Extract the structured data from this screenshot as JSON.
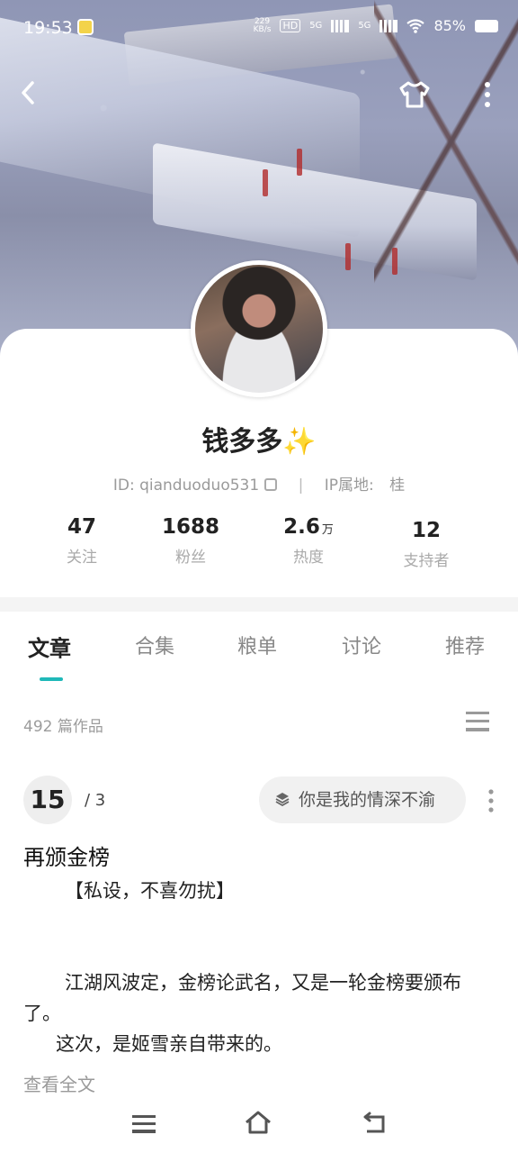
{
  "status_bar": {
    "time": "19:53",
    "net_speed_value": "229",
    "net_speed_unit": "KB/s",
    "hd_badge": "HD",
    "sim1_label": "5G",
    "sim2_label": "5G",
    "battery": "85%"
  },
  "profile": {
    "name": "钱多多✨",
    "id_label": "ID: qianduoduo531",
    "separator": "|",
    "ip_label": "IP属地:",
    "ip_value": "桂"
  },
  "stats": [
    {
      "value": "47",
      "unit": "",
      "label": "关注"
    },
    {
      "value": "1688",
      "unit": "",
      "label": "粉丝"
    },
    {
      "value": "2.6",
      "unit": "万",
      "label": "热度"
    },
    {
      "value": "12",
      "unit": "",
      "label": "支持者"
    }
  ],
  "tabs": [
    {
      "label": "文章",
      "active": true
    },
    {
      "label": "合集",
      "active": false
    },
    {
      "label": "粮单",
      "active": false
    },
    {
      "label": "讨论",
      "active": false
    },
    {
      "label": "推荐",
      "active": false
    }
  ],
  "works_count": "492 篇作品",
  "article": {
    "index": "15",
    "total": "/ 3",
    "series": "你是我的情深不渝",
    "title": "再颁金榜",
    "line1": "【私设，不喜勿扰】",
    "line2": "江湖风波定，金榜论武名，又是一轮金榜要颁布了。",
    "line3": "这次，是姬雪亲自带来的。",
    "read_more": "查看全文"
  },
  "colors": {
    "accent": "#1fb8b8",
    "text_primary": "#222222",
    "text_secondary": "#9a9a9a"
  },
  "icons": {
    "back": "chevron-left-icon",
    "shirt": "shirt-icon",
    "more": "more-vertical-icon",
    "copy": "copy-icon",
    "list": "list-icon",
    "layers": "layers-icon",
    "kebab": "kebab-icon",
    "nav_menu": "menu-icon",
    "nav_home": "home-icon",
    "nav_back": "back-icon"
  }
}
